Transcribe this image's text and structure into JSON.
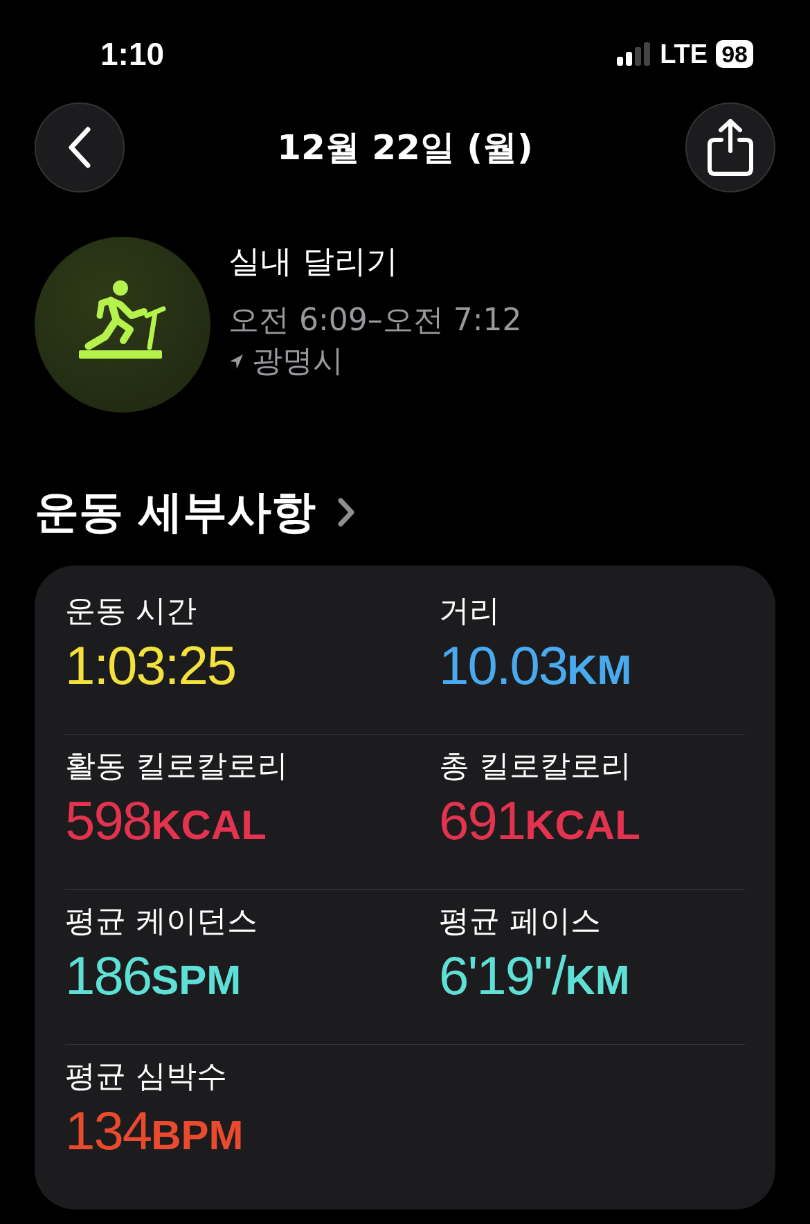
{
  "status_bar": {
    "time": "1:10",
    "network": "LTE",
    "battery": "98"
  },
  "nav": {
    "title": "12월 22일 (월)"
  },
  "workout": {
    "name": "실내 달리기",
    "time_range": "오전 6:09–오전 7:12",
    "location": "광명시"
  },
  "section": {
    "title": "운동 세부사항"
  },
  "metrics": [
    {
      "label": "운동 시간",
      "value": "1:03:25",
      "color": "#f4e23c"
    },
    {
      "label": "거리",
      "value": "10.03",
      "unit": "KM",
      "color": "#49aaf0"
    },
    {
      "label": "활동 킬로칼로리",
      "value": "598",
      "unit": "KCAL",
      "color": "#e3334f"
    },
    {
      "label": "총 킬로칼로리",
      "value": "691",
      "unit": "KCAL",
      "color": "#e3334f"
    },
    {
      "label": "평균 케이던스",
      "value": "186",
      "unit": "SPM",
      "color": "#5fe0d6"
    },
    {
      "label": "평균 페이스",
      "value": "6'19\"/",
      "unit": "KM",
      "color": "#5fe0d6"
    },
    {
      "label": "평균 심박수",
      "value": "134",
      "unit": "BPM",
      "color": "#ea4a2e"
    }
  ]
}
